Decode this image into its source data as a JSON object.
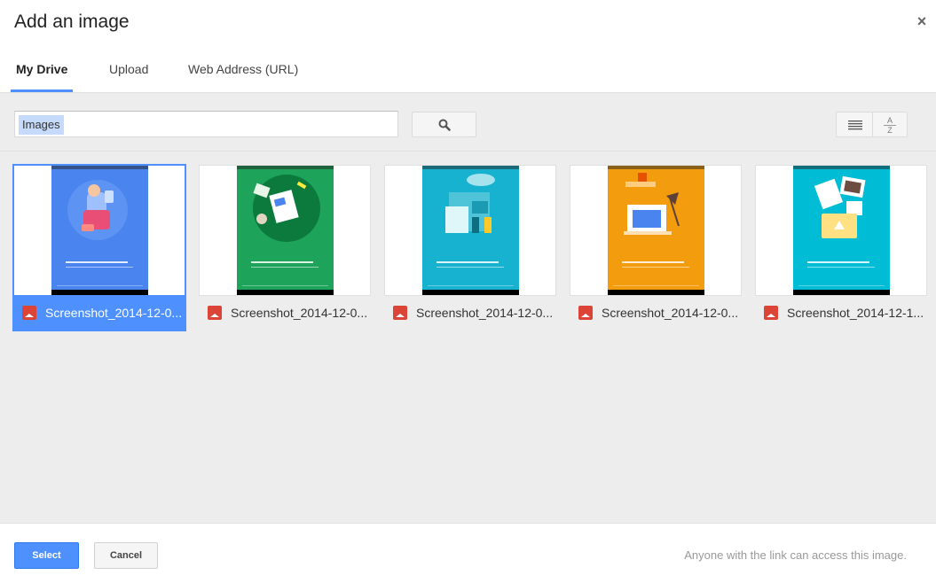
{
  "dialog": {
    "title": "Add an image",
    "close_glyph": "×"
  },
  "tabs": [
    {
      "label": "My Drive",
      "active": true
    },
    {
      "label": "Upload",
      "active": false
    },
    {
      "label": "Web Address (URL)",
      "active": false
    }
  ],
  "toolbar": {
    "search_value": "Images",
    "search_icon": "magnifier-icon",
    "list_view_icon": "list-view-icon",
    "sort_glyph_top": "A",
    "sort_glyph_bottom": "Z"
  },
  "files": [
    {
      "name": "Screenshot_2014-12-0...",
      "selected": true,
      "bg": "#4a84ef"
    },
    {
      "name": "Screenshot_2014-12-0...",
      "selected": false,
      "bg": "#1ea35a"
    },
    {
      "name": "Screenshot_2014-12-0...",
      "selected": false,
      "bg": "#17b2cf"
    },
    {
      "name": "Screenshot_2014-12-0...",
      "selected": false,
      "bg": "#f29c0e"
    },
    {
      "name": "Screenshot_2014-12-1...",
      "selected": false,
      "bg": "#00bcd4"
    }
  ],
  "footer": {
    "select_label": "Select",
    "cancel_label": "Cancel",
    "note": "Anyone with the link can access this image."
  },
  "colors": {
    "accent": "#4d90fe",
    "file_icon": "#db4437"
  }
}
